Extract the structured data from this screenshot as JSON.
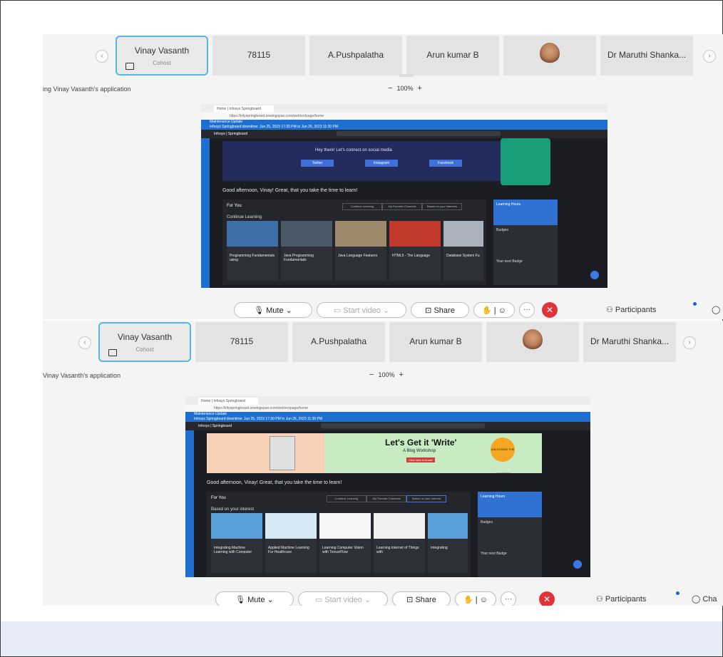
{
  "panels": [
    {
      "participants": {
        "active": {
          "name": "Vinay Vasanth",
          "role": "Cohost"
        },
        "others": [
          "78115",
          "A.Pushpalatha",
          "Arun kumar B",
          "",
          "Dr Maruthi Shanka..."
        ]
      },
      "sharing_label": "ing Vinay Vasanth's application",
      "zoom": {
        "minus": "−",
        "value": "100%",
        "plus": "+"
      },
      "shared": {
        "tab_title": "Home | Infosys Springboard",
        "url": "https://infyspringboard.onwingspan.com/web/en/page/home",
        "maintenance": "Maintenance Update",
        "maintenance_sub": "Infosys Springboard downtime: Jun 25, 2023 17:30 PM to Jun 26, 2023 11:30 PM",
        "logo": "Infosys | Springboard",
        "hero_text": "Hey there! Let's connect on social media",
        "hero_buttons": [
          "Twitter",
          "Instagram",
          "Facebook"
        ],
        "greeting": "Good afternoon, Vinay! Great, that you take the time to learn!",
        "section_title": "For You",
        "section_sub": "Continue Learning",
        "tabs": [
          "Continue Learning",
          "My Favorite Channels",
          "Based on your interests"
        ],
        "cards": [
          "Programming Fundamentals using",
          "Java Programming Fundamentals",
          "Java Language Features",
          "HTML5 - The Language",
          "Database System Fu"
        ],
        "learning_hours": "Learning Hours",
        "badges": "Badges",
        "your_badge": "Your next Badge"
      },
      "controls": {
        "mute": "Mute",
        "start_video": "Start video",
        "share": "Share",
        "participants": "Participants",
        "chat": ""
      }
    },
    {
      "participants": {
        "active": {
          "name": "Vinay Vasanth",
          "role": "Cohost"
        },
        "others": [
          "78115",
          "A.Pushpalatha",
          "Arun kumar B",
          "",
          "Dr Maruthi Shanka..."
        ]
      },
      "sharing_label": "Vinay Vasanth's application",
      "zoom": {
        "minus": "−",
        "value": "100%",
        "plus": "+"
      },
      "shared": {
        "tab_title": "Home | Infosys Springboard",
        "url": "https://infyspringboard.onwingspan.com/web/en/page/home",
        "maintenance": "Maintenance Update",
        "maintenance_sub": "Infosys Springboard downtime: Jun 25, 2023 17:30 PM to Jun 26, 2023 11:30 PM",
        "logo": "Infosys | Springboard",
        "hero_title": "Let's Get it 'Write'",
        "hero_sub": "A Blog Workshop",
        "hero_cta": "Click here to know!",
        "hero_badge": "UNLOCKING THE WONDERS",
        "greeting": "Good afternoon, Vinay! Great, that you take the time to learn!",
        "section_title": "For You",
        "section_sub": "Based on your interest",
        "tabs": [
          "Continue Learning",
          "My Favorite Channels",
          "Based on your interest"
        ],
        "cards": [
          "Integrating Machine Learning with Computer",
          "Applied Machine Learning For Healthcare",
          "Learning Computer Vision with TensorFlow",
          "Learning Internet of Things with",
          "Integrating"
        ],
        "learning_hours": "Learning Hours",
        "badges": "Badges",
        "your_badge": "Your next Badge"
      },
      "controls": {
        "mute": "Mute",
        "start_video": "Start video",
        "share": "Share",
        "participants": "Participants",
        "chat": "Cha"
      }
    }
  ],
  "colors": {
    "accent_blue": "#1f6fd0",
    "end_red": "#e0343a",
    "active_border": "#5ab3e6",
    "bottom_band": "#e8ecf9"
  }
}
